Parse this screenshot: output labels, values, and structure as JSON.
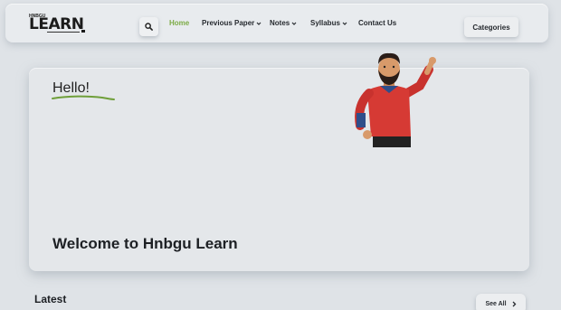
{
  "header": {
    "logo": {
      "badge": "HNBGU",
      "word": "LEARN"
    },
    "nav": [
      {
        "label": "Home",
        "active": true,
        "dropdown": false
      },
      {
        "label": "Previous Paper",
        "active": false,
        "dropdown": true
      },
      {
        "label": "Notes",
        "active": false,
        "dropdown": true
      },
      {
        "label": "Syllabus",
        "active": false,
        "dropdown": true
      },
      {
        "label": "Contact Us",
        "active": false,
        "dropdown": false
      }
    ],
    "categories_label": "Categories",
    "search_icon": "search-icon"
  },
  "hero": {
    "greeting": "Hello!",
    "welcome": "Welcome to Hnbgu Learn",
    "illustration": "waving-man-illustration"
  },
  "latest": {
    "title": "Latest",
    "see_all_label": "See All"
  },
  "colors": {
    "accent": "#7cab45",
    "background": "#dfe3e7",
    "shirt": "#d63a34"
  }
}
